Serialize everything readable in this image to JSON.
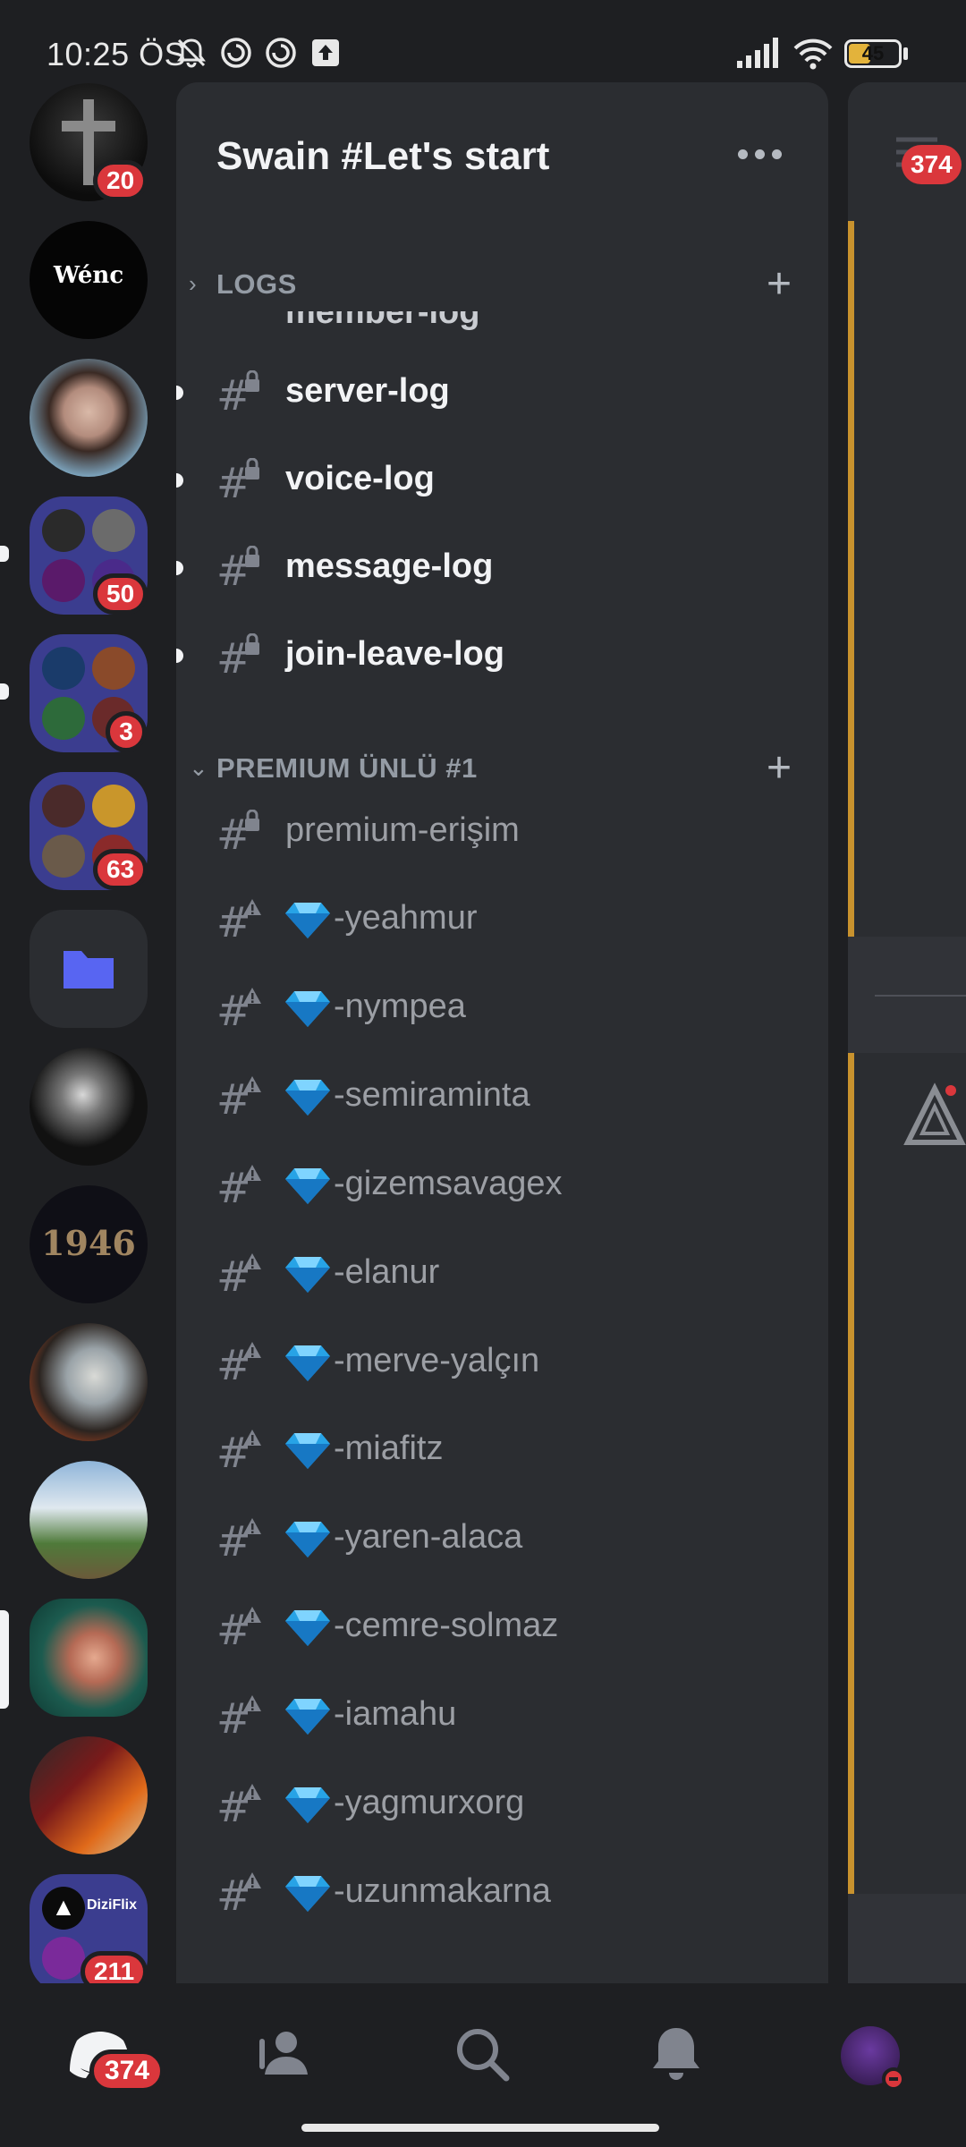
{
  "status_bar": {
    "time": "10:25 ÖS",
    "battery": "45",
    "battery_level": 0.45
  },
  "servers": [
    {
      "name": "server-cross",
      "badge": "20"
    },
    {
      "name": "server-wenc",
      "logo_text": "Wénc",
      "badge": ""
    },
    {
      "name": "server-portrait",
      "badge": ""
    },
    {
      "name": "server-group-a",
      "badge": "50"
    },
    {
      "name": "server-group-b",
      "badge": "3"
    },
    {
      "name": "server-group-c",
      "badge": "63"
    },
    {
      "name": "server-folder",
      "badge": ""
    },
    {
      "name": "server-bw-person",
      "badge": ""
    },
    {
      "name": "server-1946",
      "logo_text": "1946",
      "badge": ""
    },
    {
      "name": "server-art",
      "badge": ""
    },
    {
      "name": "server-landscape",
      "badge": ""
    },
    {
      "name": "server-girl",
      "badge": ""
    },
    {
      "name": "server-comic",
      "badge": ""
    },
    {
      "name": "server-dizi",
      "logo_text": "DiziFlix",
      "badge": "211"
    }
  ],
  "panel": {
    "server_title": "Swain #Let's start",
    "categories": [
      {
        "label": "LOGS",
        "expanded": false
      },
      {
        "label": "PREMIUM ÜNLÜ #1",
        "expanded": true
      }
    ],
    "log_channels_cut": "member-log",
    "log_channels": [
      "server-log",
      "voice-log",
      "message-log",
      "join-leave-log"
    ],
    "premium_access": "premium-erişim",
    "premium_channels": [
      "-yeahmur",
      "-nympea",
      "-semiraminta",
      "-gizemsavagex",
      "-elanur",
      "-merve-yalçın",
      "-miafitz",
      "-yaren-alaca",
      "-cemre-solmaz",
      "-iamahu",
      "-yagmurxorg",
      "-uzunmakarna"
    ]
  },
  "chat": {
    "badge": "374"
  },
  "nav": {
    "home_badge": "374"
  },
  "colors": {
    "badge": "#da373c",
    "embed_bar": "#c8922e",
    "panel_bg": "#2b2d31",
    "rail_bg": "#1e1f22"
  }
}
